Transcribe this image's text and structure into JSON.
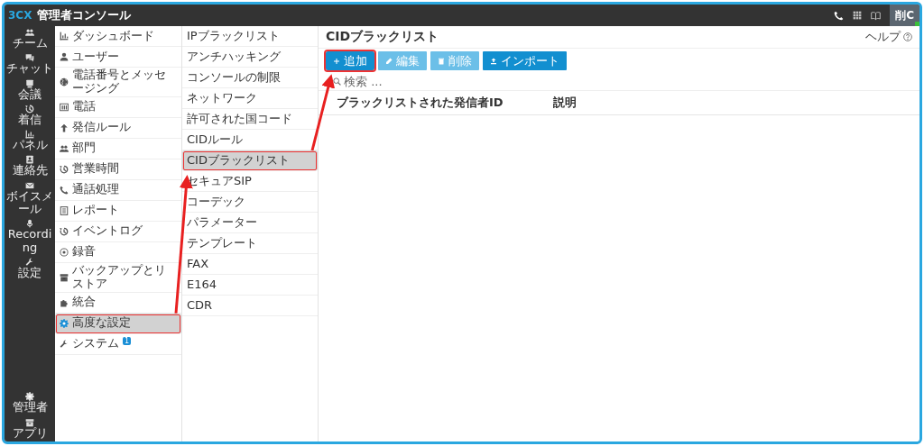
{
  "topbar": {
    "logo": "3CX",
    "title": "管理者コンソール",
    "avatar": "削C",
    "online": true
  },
  "rail": {
    "items": [
      {
        "label": "チーム"
      },
      {
        "label": "チャット"
      },
      {
        "label": "会議"
      },
      {
        "label": "着信"
      },
      {
        "label": "パネル"
      },
      {
        "label": "連絡先"
      },
      {
        "label": "ボイスメール"
      },
      {
        "label": "Recording"
      },
      {
        "label": "設定"
      }
    ],
    "bottom": [
      {
        "label": "管理者"
      },
      {
        "label": "アプリ"
      }
    ]
  },
  "nav": {
    "items": [
      {
        "label": "ダッシュボード",
        "selected": false,
        "highlighted": false
      },
      {
        "label": "ユーザー",
        "selected": false,
        "highlighted": false
      },
      {
        "label": "電話番号とメッセージング",
        "selected": false,
        "highlighted": false
      },
      {
        "label": "電話",
        "selected": false,
        "highlighted": false
      },
      {
        "label": "発信ルール",
        "selected": false,
        "highlighted": false
      },
      {
        "label": "部門",
        "selected": false,
        "highlighted": false
      },
      {
        "label": "営業時間",
        "selected": false,
        "highlighted": false
      },
      {
        "label": "通話処理",
        "selected": false,
        "highlighted": false
      },
      {
        "label": "レポート",
        "selected": false,
        "highlighted": false
      },
      {
        "label": "イベントログ",
        "selected": false,
        "highlighted": false
      },
      {
        "label": "録音",
        "selected": false,
        "highlighted": false
      },
      {
        "label": "バックアップとリストア",
        "selected": false,
        "highlighted": false
      },
      {
        "label": "統合",
        "selected": false,
        "highlighted": false
      },
      {
        "label": "高度な設定",
        "selected": true,
        "highlighted": true
      },
      {
        "label": "システム",
        "selected": false,
        "highlighted": false,
        "badge": "1"
      }
    ]
  },
  "subnav": {
    "items": [
      {
        "label": "IPブラックリスト",
        "selected": false,
        "highlighted": false
      },
      {
        "label": "アンチハッキング",
        "selected": false,
        "highlighted": false
      },
      {
        "label": "コンソールの制限",
        "selected": false,
        "highlighted": false
      },
      {
        "label": "ネットワーク",
        "selected": false,
        "highlighted": false
      },
      {
        "label": "許可された国コード",
        "selected": false,
        "highlighted": false
      },
      {
        "label": "CIDルール",
        "selected": false,
        "highlighted": false
      },
      {
        "label": "CIDブラックリスト",
        "selected": true,
        "highlighted": true
      },
      {
        "label": "セキュアSIP",
        "selected": false,
        "highlighted": false
      },
      {
        "label": "コーデック",
        "selected": false,
        "highlighted": false
      },
      {
        "label": "パラメーター",
        "selected": false,
        "highlighted": false
      },
      {
        "label": "テンプレート",
        "selected": false,
        "highlighted": false
      },
      {
        "label": "FAX",
        "selected": false,
        "highlighted": false
      },
      {
        "label": "E164",
        "selected": false,
        "highlighted": false
      },
      {
        "label": "CDR",
        "selected": false,
        "highlighted": false
      }
    ]
  },
  "content": {
    "title": "CIDブラックリスト",
    "help": "ヘルプ",
    "buttons": [
      {
        "label": "追加",
        "kind": "add",
        "disabled": false,
        "highlighted": true
      },
      {
        "label": "編集",
        "kind": "edit",
        "disabled": true,
        "highlighted": false
      },
      {
        "label": "削除",
        "kind": "delete",
        "disabled": true,
        "highlighted": false
      },
      {
        "label": "インポート",
        "kind": "import",
        "disabled": false,
        "highlighted": false
      }
    ],
    "search": {
      "placeholder": "検索 ..."
    },
    "table": {
      "columns": [
        "ブラックリストされた発信者ID",
        "説明"
      ]
    }
  }
}
